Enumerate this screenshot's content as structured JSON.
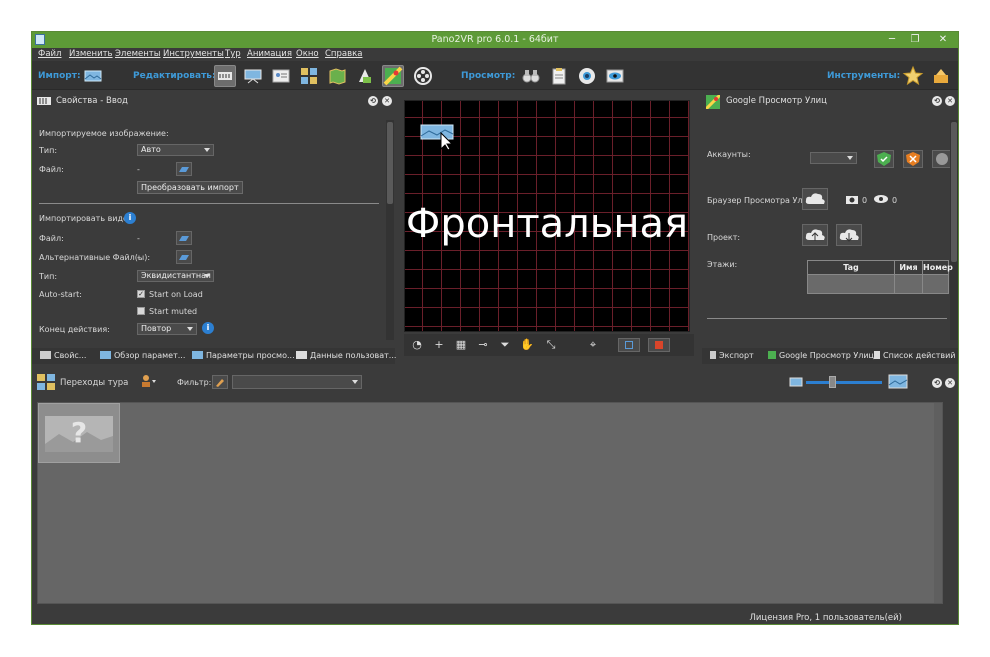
{
  "window": {
    "title": "Pano2VR pro 6.0.1 - 64бит",
    "controls": {
      "minimize": "─",
      "maximize": "❐",
      "close": "✕"
    }
  },
  "menu": {
    "items": [
      "Файл",
      "Изменить",
      "Элементы",
      "Инструменты",
      "Тур",
      "Анимация",
      "Окно",
      "Справка"
    ]
  },
  "toolbar": {
    "import_label": "Импорт:",
    "edit_label": "Редактировать:",
    "preview_label": "Просмотр:",
    "tools_label": "Инструменты:",
    "accent_color": "#3e9ad8"
  },
  "properties_panel": {
    "title": "Свойства - Ввод",
    "import_image_heading": "Импортируемое изображение:",
    "type_label": "Тип:",
    "type_value": "Авто",
    "file_label": "Файл:",
    "file_value": "-",
    "convert_button": "Преобразовать импорт",
    "import_video_heading": "Импортировать видео:",
    "video_file_label": "Файл:",
    "video_file_value": "-",
    "alt_files_label": "Альтернативные Файл(ы):",
    "alt_files_value": "-",
    "video_type_label": "Тип:",
    "video_type_value": "Эквидистантная",
    "autostart_label": "Auto-start:",
    "start_on_load": "Start on Load",
    "start_muted": "Start muted",
    "end_action_label": "Конец действия:",
    "end_action_value": "Повтор",
    "tabs": [
      "Свойс...",
      "Обзор парамет...",
      "Параметры просмо...",
      "Данные пользоват..."
    ]
  },
  "viewer": {
    "face_label": "Фронтальная",
    "grid_color": "#6a1f2a"
  },
  "streetview_panel": {
    "title": "Google Просмотр Улиц",
    "accounts_label": "Аккаунты:",
    "browser_label": "Браузер Просмотра Улиц:",
    "photo_count": "0",
    "view_count": "0",
    "project_label": "Проект:",
    "floors_label": "Этажи:",
    "table_headers": [
      "Tag",
      "Имя",
      "Номер"
    ],
    "tabs": [
      "Экспорт",
      "Google Просмотр Улиц",
      "Список действий"
    ]
  },
  "tour_panel": {
    "title": "Переходы тура",
    "filter_label": "Фильтр:",
    "filter_value": ""
  },
  "status": {
    "license": "Лицензия Pro, 1 пользователь(ей)"
  }
}
